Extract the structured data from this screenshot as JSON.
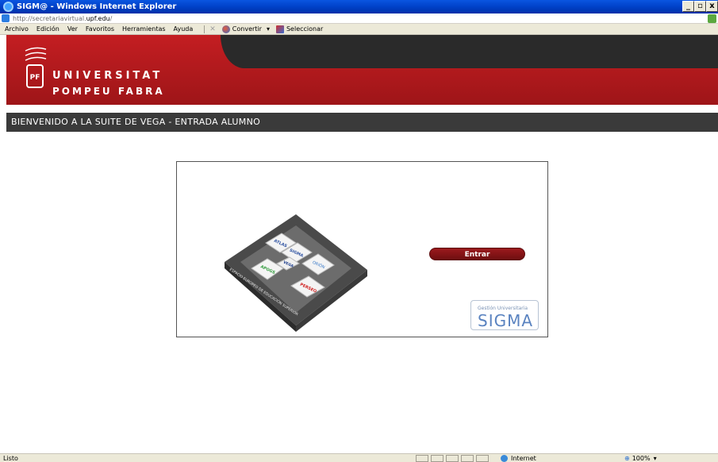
{
  "window": {
    "title": "SIGM@ - Windows Internet Explorer",
    "minimize_label": "_",
    "maximize_label": "▫",
    "close_label": "x"
  },
  "address": {
    "scheme_path": "http://secretariavirtual.",
    "host": "upf.edu",
    "trail": "/"
  },
  "menu": {
    "items": [
      "Archivo",
      "Edición",
      "Ver",
      "Favoritos",
      "Herramientas",
      "Ayuda"
    ],
    "convert_label": "Convertir",
    "convert_arrow": "▾",
    "select_label": "Seleccionar"
  },
  "header": {
    "line1": "UNIVERSITAT",
    "line2": "POMPEU FABRA"
  },
  "welcome": {
    "title": "BIENVENIDO A LA SUITE DE VEGA - ENTRADA ALUMNO"
  },
  "illustration": {
    "tiles": [
      "ATLAS",
      "SIGMA",
      "ORIÓN",
      "APOGS",
      "VEGA",
      "PERSEO"
    ],
    "base_text": "ESPACIO EUROPEO DE EDUCACIÓN SUPERIOR"
  },
  "login": {
    "enter_label": "Entrar"
  },
  "badge": {
    "small": "Gestión Universitaria",
    "big": "SIGMA"
  },
  "status": {
    "text": "Listo",
    "zone": "Internet",
    "zoom": "100%",
    "zoom_arrow": "▾"
  },
  "colors": {
    "brand_red": "#c41e22",
    "dark_band": "#2a2a2a",
    "button_red": "#8a1418",
    "sigma_blue": "#5a83c0"
  }
}
